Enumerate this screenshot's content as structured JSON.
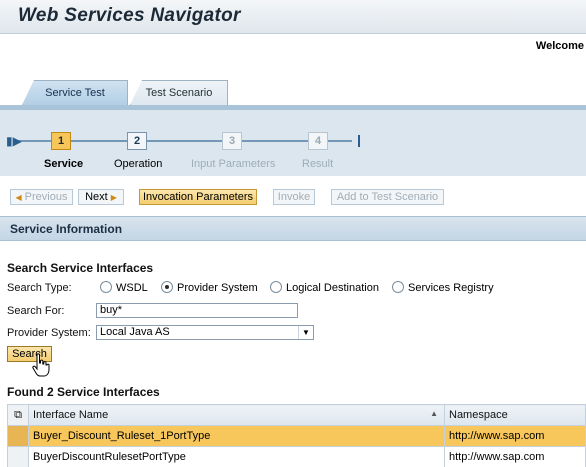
{
  "app": {
    "title": "Web Services Navigator",
    "welcome": "Welcome"
  },
  "tabs": [
    {
      "label": "Service Test",
      "active": true
    },
    {
      "label": "Test Scenario",
      "active": false
    }
  ],
  "roadmap": {
    "steps": [
      {
        "number": "1",
        "label": "Service",
        "state": "current"
      },
      {
        "number": "2",
        "label": "Operation",
        "state": "enabled"
      },
      {
        "number": "3",
        "label": "Input Parameters",
        "state": "disabled"
      },
      {
        "number": "4",
        "label": "Result",
        "state": "disabled"
      }
    ]
  },
  "toolbar": {
    "previous": "Previous",
    "next": "Next",
    "invocation_parameters": "Invocation Parameters",
    "invoke": "Invoke",
    "add_to_scenario": "Add to Test Scenario"
  },
  "section": {
    "title": "Service Information"
  },
  "search": {
    "group_title": "Search Service Interfaces",
    "search_type_label": "Search Type:",
    "options": [
      {
        "label": "WSDL",
        "selected": false
      },
      {
        "label": "Provider System",
        "selected": true
      },
      {
        "label": "Logical Destination",
        "selected": false
      },
      {
        "label": "Services Registry",
        "selected": false
      }
    ],
    "search_for_label": "Search For:",
    "search_for_value": "buy*",
    "provider_system_label": "Provider System:",
    "provider_system_value": "Local Java AS",
    "button": "Search"
  },
  "results": {
    "title": "Found 2 Service Interfaces",
    "columns": [
      "Interface Name",
      "Namespace"
    ],
    "rows": [
      {
        "name": "Buyer_Discount_Ruleset_1PortType",
        "namespace": "http://www.sap.com",
        "selected": true
      },
      {
        "name": "BuyerDiscountRulesetPortType",
        "namespace": "http://www.sap.com",
        "selected": false
      }
    ]
  },
  "colors": {
    "accent": "#f4cd70",
    "selection": "#f7c75c",
    "header_blue": "#c4d5e4"
  }
}
